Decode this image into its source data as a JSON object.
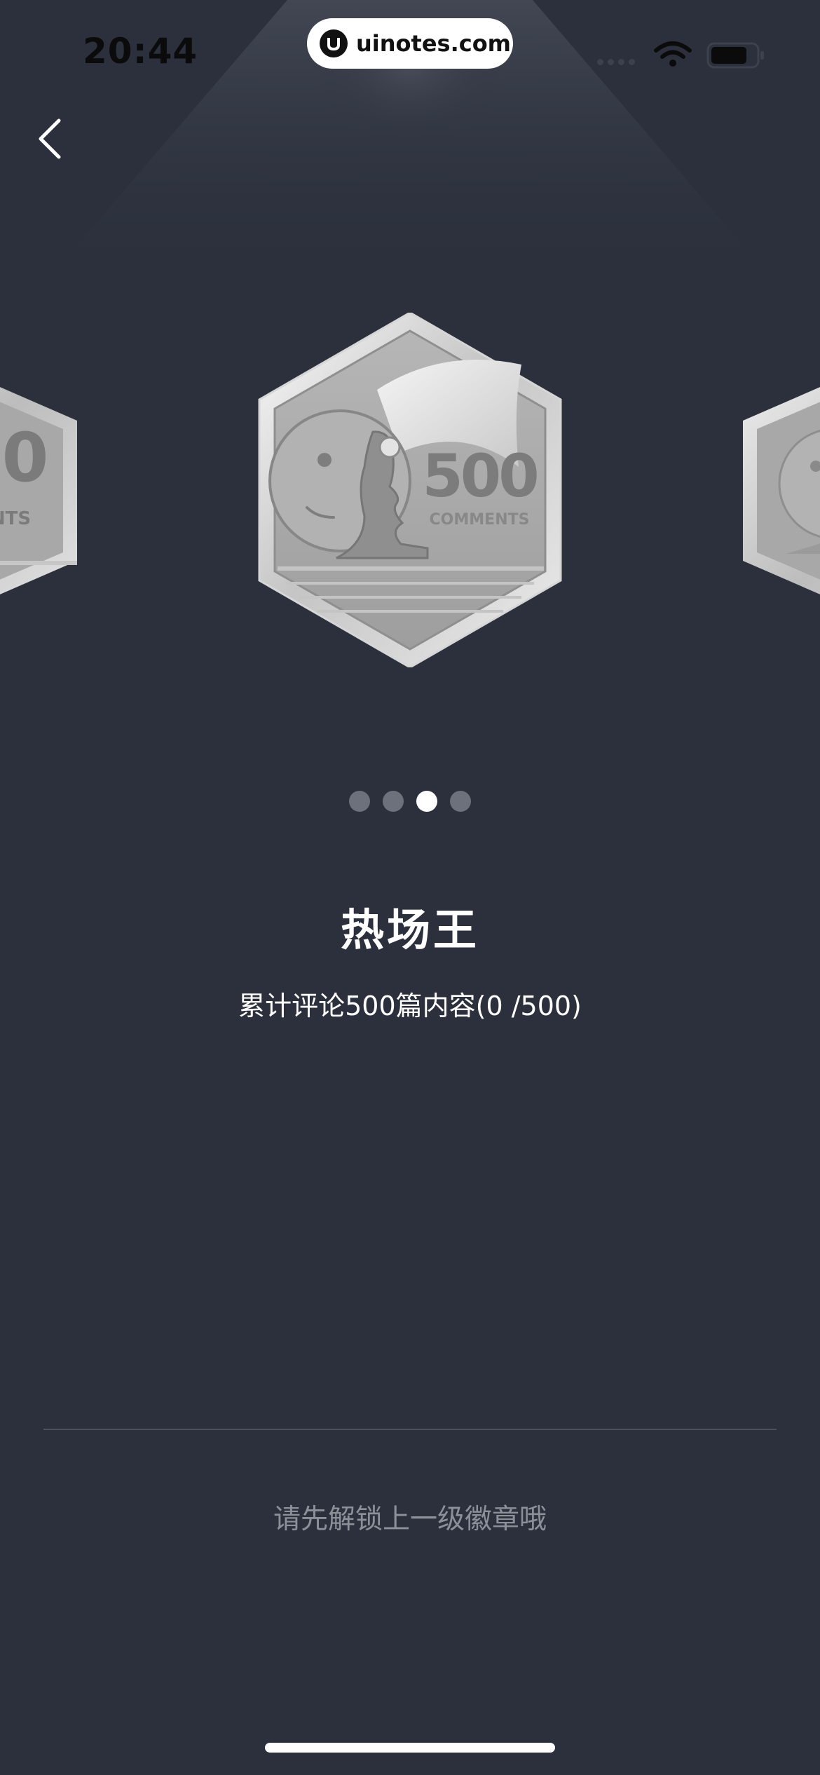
{
  "status_bar": {
    "time": "20:44",
    "watermark": "uinotes.com"
  },
  "icons": {
    "back": "chevron-left-icon",
    "wifi": "wifi-icon",
    "battery": "battery-icon"
  },
  "badge": {
    "main_number": "500",
    "main_caption": "COMMENTS",
    "left_number": "0",
    "left_caption": "NTS",
    "title": "热场王",
    "description": "累计评论500篇内容(0 /500)"
  },
  "pager": {
    "total": 4,
    "active_index": 2
  },
  "footer": {
    "unlock_hint": "请先解锁上一级徽章哦"
  },
  "colors": {
    "background": "#2b303c",
    "pager_active": "#ffffff",
    "pager_inactive": "#6c717b",
    "hint_text": "#8b9099"
  }
}
